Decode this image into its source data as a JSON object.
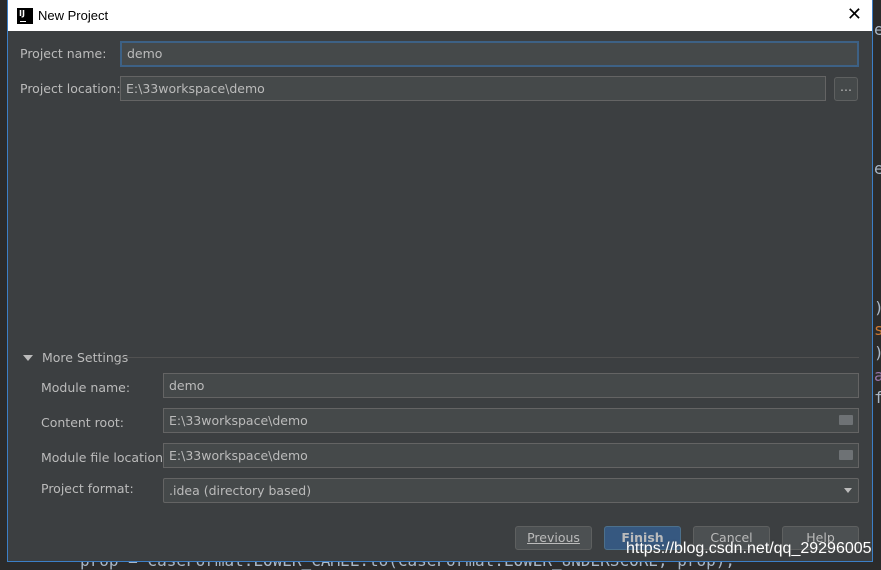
{
  "window": {
    "title": "New Project"
  },
  "form": {
    "project_name_label": "Project name:",
    "project_name": "demo",
    "project_location_label": "Project location:",
    "project_location": "E:\\33workspace\\demo",
    "browse_label": "..."
  },
  "more_settings": {
    "label": "More Settings",
    "module_name_label": "Module name:",
    "module_name": "demo",
    "content_root_label": "Content root:",
    "content_root": "E:\\33workspace\\demo",
    "module_file_location_label": "Module file location:",
    "module_file_location": "E:\\33workspace\\demo",
    "project_format_label": "Project format:",
    "project_format": ".idea (directory based)"
  },
  "buttons": {
    "previous": "Previous",
    "finish": "Finish",
    "cancel": "Cancel",
    "help": "Help"
  },
  "background_editor": {
    "code": "prop = CaseFormat.LOWER_CAMEL.to(CaseFormat.LOWER_UNDERSCORE, prop);",
    "chars": [
      "e",
      "e",
      ")",
      "s",
      ")",
      "a",
      "f"
    ]
  },
  "watermark": "https://blog.csdn.net/qq_29296005",
  "colors": {
    "accent": "#3c7fc6",
    "primary_button": "#365880",
    "dialog_bg": "#3c3f41"
  }
}
